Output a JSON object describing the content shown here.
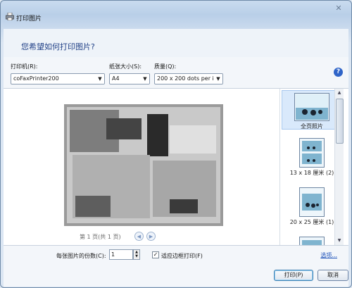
{
  "window": {
    "title": "打印图片",
    "close_symbol": "✕"
  },
  "heading": "您希望如何打印图片?",
  "printer": {
    "label": "打印机(R):",
    "value": "coFaxPrinter200"
  },
  "paper_size": {
    "label": "纸张大小(S):",
    "value": "A4"
  },
  "quality": {
    "label": "质量(Q):",
    "value": "200 x 200 dots per in"
  },
  "help_symbol": "?",
  "preview": {
    "page_label": "第 1 页(共 1 页)"
  },
  "thumbnails": [
    {
      "label": "全页照片",
      "selected": true
    },
    {
      "label": "13 x 18 厘米 (2)",
      "selected": false
    },
    {
      "label": "20 x 25 厘米 (1)",
      "selected": false
    },
    {
      "label": "",
      "selected": false
    }
  ],
  "options": {
    "copies_label": "每张图片的份数(C):",
    "copies_value": "1",
    "fit_label": "适应边框打印(F)",
    "fit_checked": true,
    "options_link": "选项..."
  },
  "buttons": {
    "print": "打印(P)",
    "cancel": "取消"
  },
  "colors": {
    "accent": "#1f3f86",
    "help": "#2f64c8",
    "link": "#1a4fb8"
  }
}
